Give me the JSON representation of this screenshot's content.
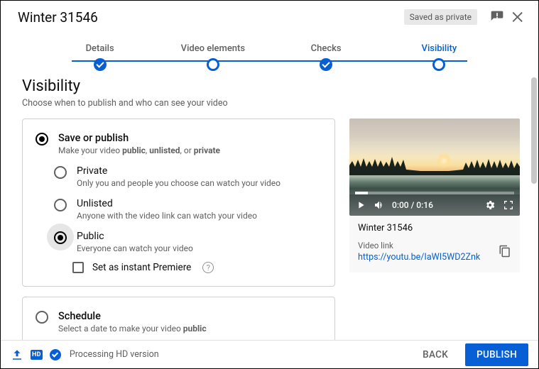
{
  "header": {
    "title": "Winter 31546",
    "badge": "Saved as private"
  },
  "stepper": {
    "s1": "Details",
    "s2": "Video elements",
    "s3": "Checks",
    "s4": "Visibility"
  },
  "page": {
    "title": "Visibility",
    "sub": "Choose when to publish and who can see your video"
  },
  "save": {
    "title": "Save or publish",
    "sub_pre": "Make your video ",
    "sub_b1": "public",
    "sub_mid1": ", ",
    "sub_b2": "unlisted",
    "sub_mid2": ", or ",
    "sub_b3": "private"
  },
  "opts": {
    "private": {
      "label": "Private",
      "sub": "Only you and people you choose can watch your video"
    },
    "unlisted": {
      "label": "Unlisted",
      "sub": "Anyone with the video link can watch your video"
    },
    "public": {
      "label": "Public",
      "sub": "Everyone can watch your video"
    }
  },
  "premiere": {
    "label": "Set as instant Premiere"
  },
  "schedule": {
    "title": "Schedule",
    "sub_pre": "Select a date to make your video ",
    "sub_b": "public"
  },
  "video": {
    "time": "0:00 / 0:16",
    "title": "Winter 31546",
    "link_label": "Video link",
    "link": "https://youtu.be/IaWI5WD2Znk"
  },
  "footer": {
    "hd": "HD",
    "processing": "Processing HD version",
    "back": "BACK",
    "publish": "PUBLISH"
  }
}
